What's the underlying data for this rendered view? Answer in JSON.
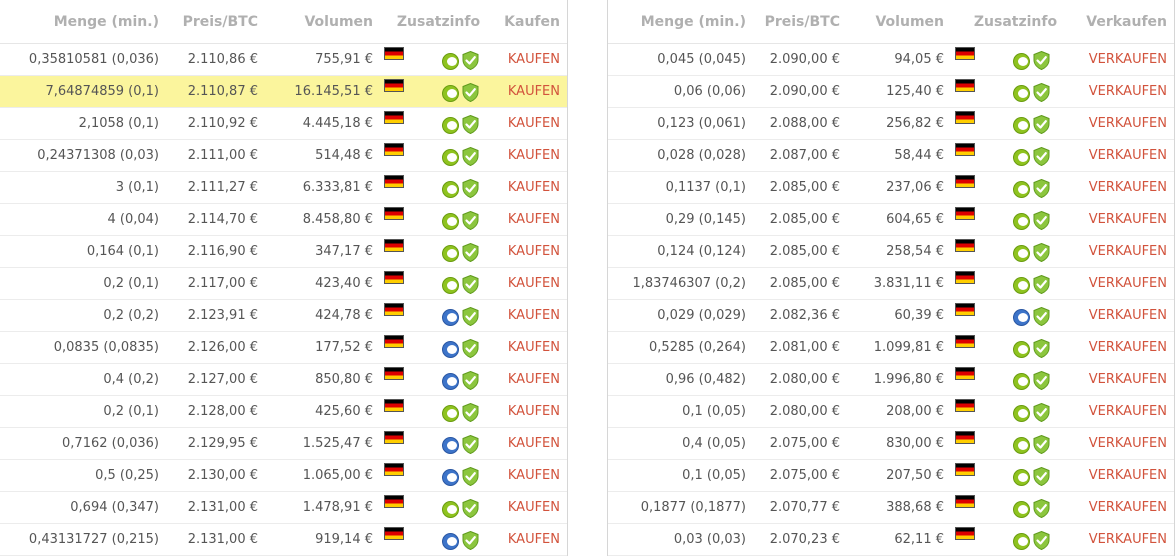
{
  "left": {
    "headers": [
      "Menge (min.)",
      "Preis/BTC",
      "Volumen",
      "Zusatzinfo",
      "Kaufen"
    ],
    "action_label": "KAUFEN",
    "rows": [
      {
        "menge": "0,35810581 (0,036)",
        "preis": "2.110,86 €",
        "volumen": "755,91 €",
        "badge": "green"
      },
      {
        "menge": "7,64874859 (0,1)",
        "preis": "2.110,87 €",
        "volumen": "16.145,51 €",
        "badge": "green"
      },
      {
        "menge": "2,1058 (0,1)",
        "preis": "2.110,92 €",
        "volumen": "4.445,18 €",
        "badge": "green"
      },
      {
        "menge": "0,24371308 (0,03)",
        "preis": "2.111,00 €",
        "volumen": "514,48 €",
        "badge": "green"
      },
      {
        "menge": "3 (0,1)",
        "preis": "2.111,27 €",
        "volumen": "6.333,81 €",
        "badge": "green"
      },
      {
        "menge": "4 (0,04)",
        "preis": "2.114,70 €",
        "volumen": "8.458,80 €",
        "badge": "green"
      },
      {
        "menge": "0,164 (0,1)",
        "preis": "2.116,90 €",
        "volumen": "347,17 €",
        "badge": "green"
      },
      {
        "menge": "0,2 (0,1)",
        "preis": "2.117,00 €",
        "volumen": "423,40 €",
        "badge": "green"
      },
      {
        "menge": "0,2 (0,2)",
        "preis": "2.123,91 €",
        "volumen": "424,78 €",
        "badge": "blue"
      },
      {
        "menge": "0,0835 (0,0835)",
        "preis": "2.126,00 €",
        "volumen": "177,52 €",
        "badge": "blue"
      },
      {
        "menge": "0,4 (0,2)",
        "preis": "2.127,00 €",
        "volumen": "850,80 €",
        "badge": "blue"
      },
      {
        "menge": "0,2 (0,1)",
        "preis": "2.128,00 €",
        "volumen": "425,60 €",
        "badge": "green"
      },
      {
        "menge": "0,7162 (0,036)",
        "preis": "2.129,95 €",
        "volumen": "1.525,47 €",
        "badge": "blue"
      },
      {
        "menge": "0,5 (0,25)",
        "preis": "2.130,00 €",
        "volumen": "1.065,00 €",
        "badge": "blue"
      },
      {
        "menge": "0,694 (0,347)",
        "preis": "2.131,00 €",
        "volumen": "1.478,91 €",
        "badge": "green"
      },
      {
        "menge": "0,43131727 (0,215)",
        "preis": "2.131,00 €",
        "volumen": "919,14 €",
        "badge": "blue"
      }
    ],
    "highlighted_row": 1
  },
  "right": {
    "headers": [
      "Menge (min.)",
      "Preis/BTC",
      "Volumen",
      "Zusatzinfo",
      "Verkaufen"
    ],
    "action_label": "VERKAUFEN",
    "rows": [
      {
        "menge": "0,045 (0,045)",
        "preis": "2.090,00 €",
        "volumen": "94,05 €",
        "badge": "green"
      },
      {
        "menge": "0,06 (0,06)",
        "preis": "2.090,00 €",
        "volumen": "125,40 €",
        "badge": "green"
      },
      {
        "menge": "0,123 (0,061)",
        "preis": "2.088,00 €",
        "volumen": "256,82 €",
        "badge": "green"
      },
      {
        "menge": "0,028 (0,028)",
        "preis": "2.087,00 €",
        "volumen": "58,44 €",
        "badge": "green"
      },
      {
        "menge": "0,1137 (0,1)",
        "preis": "2.085,00 €",
        "volumen": "237,06 €",
        "badge": "green"
      },
      {
        "menge": "0,29 (0,145)",
        "preis": "2.085,00 €",
        "volumen": "604,65 €",
        "badge": "green"
      },
      {
        "menge": "0,124 (0,124)",
        "preis": "2.085,00 €",
        "volumen": "258,54 €",
        "badge": "green"
      },
      {
        "menge": "1,83746307 (0,2)",
        "preis": "2.085,00 €",
        "volumen": "3.831,11 €",
        "badge": "green"
      },
      {
        "menge": "0,029 (0,029)",
        "preis": "2.082,36 €",
        "volumen": "60,39 €",
        "badge": "blue"
      },
      {
        "menge": "0,5285 (0,264)",
        "preis": "2.081,00 €",
        "volumen": "1.099,81 €",
        "badge": "green"
      },
      {
        "menge": "0,96 (0,482)",
        "preis": "2.080,00 €",
        "volumen": "1.996,80 €",
        "badge": "green"
      },
      {
        "menge": "0,1 (0,05)",
        "preis": "2.080,00 €",
        "volumen": "208,00 €",
        "badge": "green"
      },
      {
        "menge": "0,4 (0,05)",
        "preis": "2.075,00 €",
        "volumen": "830,00 €",
        "badge": "green"
      },
      {
        "menge": "0,1 (0,05)",
        "preis": "2.075,00 €",
        "volumen": "207,50 €",
        "badge": "green"
      },
      {
        "menge": "0,1877 (0,1877)",
        "preis": "2.070,77 €",
        "volumen": "388,68 €",
        "badge": "green"
      },
      {
        "menge": "0,03 (0,03)",
        "preis": "2.070,23 €",
        "volumen": "62,11 €",
        "badge": "green"
      }
    ],
    "highlighted_row": -1
  },
  "colors": {
    "action_text": "#d2533c",
    "header_text": "#b0b0b0",
    "highlight_row": "#fbf59d",
    "badge_green": "#8fc31f",
    "badge_blue": "#3d74c9",
    "shield_green": "#8cc63e"
  },
  "icons": {
    "flag": "germany-flag-icon",
    "badge": "trust-level-icon",
    "shield": "verified-shield-icon"
  }
}
